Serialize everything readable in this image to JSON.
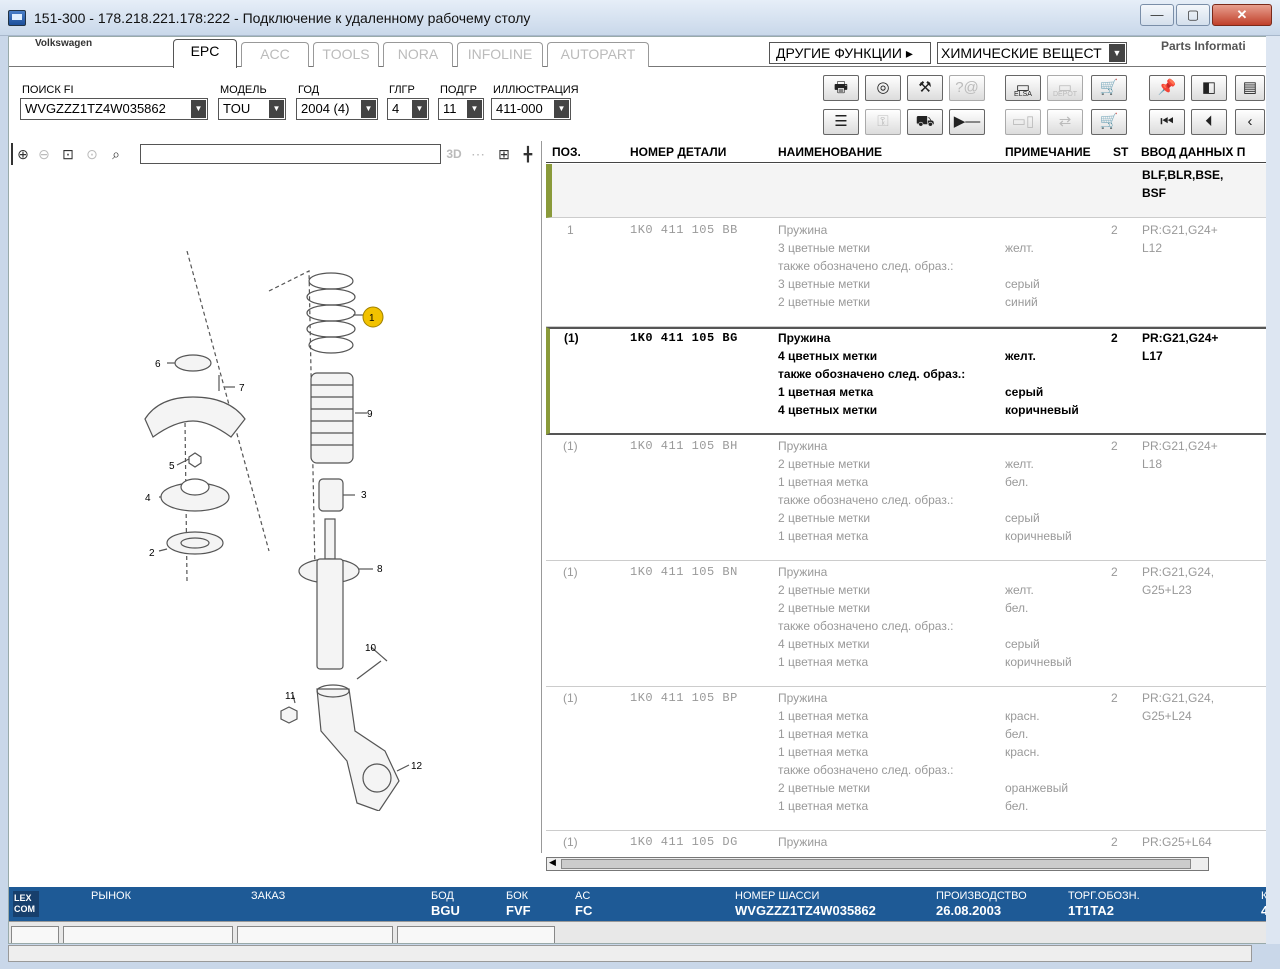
{
  "window": {
    "title": "151-300 - 178.218.221.178:222 - Подключение к удаленному рабочему столу"
  },
  "topbar": {
    "brand": "Volkswagen",
    "tabs": [
      {
        "label": "EPC",
        "active": true
      },
      {
        "label": "ACC",
        "active": false
      },
      {
        "label": "TOOLS",
        "active": false
      },
      {
        "label": "NORA",
        "active": false
      },
      {
        "label": "INFOLINE",
        "active": false
      },
      {
        "label": "AUTOPART",
        "active": false
      }
    ],
    "other_functions": "ДРУГИЕ ФУНКЦИИ",
    "chem_select": "ХИМИЧЕСКИЕ ВЕЩЕСТ",
    "parts_info": "Parts Informati"
  },
  "filters": {
    "search_fi": {
      "label": "ПОИСК FI",
      "value": "WVGZZZ1TZ4W035862"
    },
    "model": {
      "label": "МОДЕЛЬ",
      "value": "TOU"
    },
    "year": {
      "label": "ГОД",
      "value": "2004 (4)"
    },
    "maingroup": {
      "label": "ГЛГР",
      "value": "4"
    },
    "subgroup": {
      "label": "ПОДГР",
      "value": "11"
    },
    "illustration": {
      "label": "ИЛЛЮСТРАЦИЯ",
      "value": "411-000"
    }
  },
  "toolbar": {
    "elsa": "ELSA",
    "depot": "DEPOT"
  },
  "viewer": {
    "mode_3d": "3D"
  },
  "table": {
    "headers": {
      "pos": "ПОЗ.",
      "partno": "НОМЕР ДЕТАЛИ",
      "name": "НАИМЕНОВАНИЕ",
      "note": "ПРИМЕЧАНИЕ",
      "st": "ST",
      "input": "ВВОД ДАННЫХ П"
    },
    "group_row": {
      "input": [
        "BLF,BLR,BSE,",
        "BSF"
      ]
    },
    "rows": [
      {
        "pos": "1",
        "partno": "1K0 411 105 BB",
        "names": [
          "Пружина",
          "3 цветные метки",
          "также обозначено след. образ.:",
          "3 цветные метки",
          "2 цветные метки"
        ],
        "notes": [
          "",
          "желт.",
          "",
          "серый",
          "синий"
        ],
        "st": "2",
        "input": [
          "PR:G21,G24+",
          "L12"
        ]
      },
      {
        "pos": "(1)",
        "partno": "1K0 411 105 BG",
        "names": [
          "Пружина",
          "4 цветных метки",
          "также обозначено след. образ.:",
          "1 цветная метка",
          "4 цветных метки"
        ],
        "notes": [
          "",
          "желт.",
          "",
          "серый",
          "коричневый"
        ],
        "st": "2",
        "input": [
          "PR:G21,G24+",
          "L17"
        ]
      },
      {
        "pos": "(1)",
        "partno": "1K0 411 105 BH",
        "names": [
          "Пружина",
          "2 цветные метки",
          "1 цветная метка",
          "также обозначено след. образ.:",
          "2 цветные метки",
          "1 цветная метка"
        ],
        "notes": [
          "",
          "желт.",
          "бел.",
          "",
          "серый",
          "коричневый"
        ],
        "st": "2",
        "input": [
          "PR:G21,G24+",
          "L18"
        ]
      },
      {
        "pos": "(1)",
        "partno": "1K0 411 105 BN",
        "names": [
          "Пружина",
          "2 цветные метки",
          "2 цветные метки",
          "также обозначено след. образ.:",
          "4 цветных метки",
          "1 цветная метка"
        ],
        "notes": [
          "",
          "желт.",
          "бел.",
          "",
          "серый",
          "коричневый"
        ],
        "st": "2",
        "input": [
          "PR:G21,G24,",
          "G25+L23"
        ]
      },
      {
        "pos": "(1)",
        "partno": "1K0 411 105 BP",
        "names": [
          "Пружина",
          "1 цветная метка",
          "1 цветная метка",
          "1 цветная метка",
          "также обозначено след. образ.:",
          "2 цветные метки",
          "1 цветная метка"
        ],
        "notes": [
          "",
          "красн.",
          "бел.",
          "красн.",
          "",
          "оранжевый",
          "бел."
        ],
        "st": "2",
        "input": [
          "PR:G21,G24,",
          "G25+L24"
        ]
      },
      {
        "pos": "(1)",
        "partno": "1K0 411 105 DG",
        "names": [
          "Пружина"
        ],
        "notes": [
          ""
        ],
        "st": "2",
        "input": [
          "PR:G25+L64"
        ]
      }
    ]
  },
  "statusbar": {
    "logo": "LEX COM",
    "market": "РЫНОК",
    "order": "ЗАКАЗ",
    "bod_label": "БОД",
    "bod": "BGU",
    "bok_label": "БОК",
    "bok": "FVF",
    "ac_label": "AC",
    "ac": "FC",
    "chassis_label": "НОМЕР ШАССИ",
    "chassis": "WVGZZZ1TZ4W035862",
    "production_label": "ПРОИЗВОДСТВО",
    "production": "26.08.2003",
    "trade_label": "ТОРГ.ОБОЗН.",
    "trade": "1T1TA2",
    "extra_label": "К",
    "extra": "4"
  },
  "diagram_labels": [
    "1",
    "2",
    "3",
    "4",
    "5",
    "6",
    "7",
    "8",
    "9",
    "10",
    "11",
    "12"
  ],
  "colors": {
    "accent_green": "#8a9a3a",
    "status_blue": "#1e5a96",
    "callout_yellow": "#f2c200"
  }
}
